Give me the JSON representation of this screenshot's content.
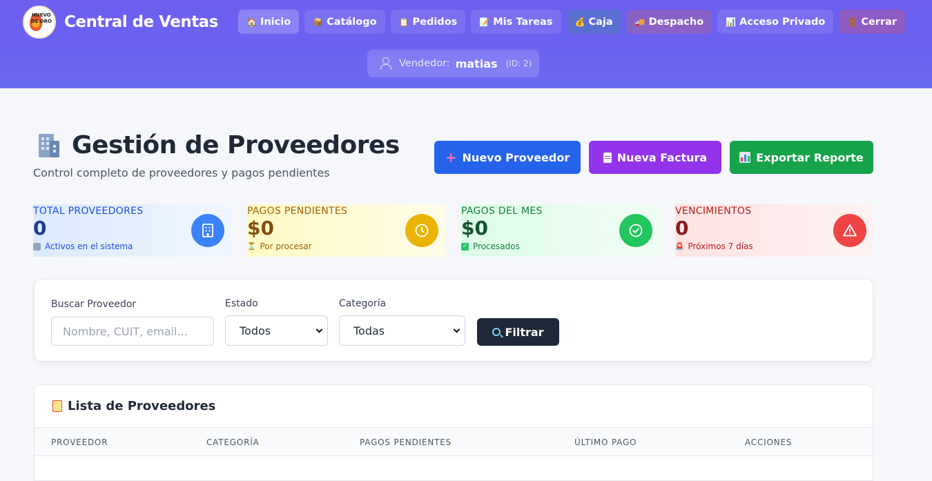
{
  "header": {
    "brand_title": "Central de Ventas",
    "logo_text": "HUEVO DE ORO",
    "nav": [
      {
        "label": "Inicio",
        "icon": "house-icon"
      },
      {
        "label": "Catálogo",
        "icon": "package-icon"
      },
      {
        "label": "Pedidos",
        "icon": "clipboard-icon"
      },
      {
        "label": "Mis Tareas",
        "icon": "memo-icon"
      },
      {
        "label": "Caja",
        "icon": "money-bag-icon"
      },
      {
        "label": "Despacho",
        "icon": "truck-icon"
      },
      {
        "label": "Acceso Privado",
        "icon": "bar-chart-icon"
      },
      {
        "label": "Cerrar",
        "icon": "door-icon"
      }
    ],
    "seller": {
      "prefix": "Vendedor:",
      "name": "matias",
      "id": "(ID: 2)"
    }
  },
  "page": {
    "title": "Gestión de Proveedores",
    "subtitle": "Control completo de proveedores y pagos pendientes"
  },
  "actions": {
    "new_provider": "Nuevo Proveedor",
    "new_invoice": "Nueva Factura",
    "export_report": "Exportar Reporte"
  },
  "stats": [
    {
      "label": "TOTAL PROVEEDORES",
      "value": "0",
      "note": "Activos en el sistema",
      "color": "#3b82f6"
    },
    {
      "label": "PAGOS PENDIENTES",
      "value": "$0",
      "note": "Por procesar",
      "color": "#eab308"
    },
    {
      "label": "PAGOS DEL MES",
      "value": "$0",
      "note": "Procesados",
      "color": "#22c55e"
    },
    {
      "label": "VENCIMIENTOS",
      "value": "0",
      "note": "Próximos 7 días",
      "color": "#ef4444"
    }
  ],
  "filters": {
    "search_label": "Buscar Proveedor",
    "search_placeholder": "Nombre, CUIT, email...",
    "estado_label": "Estado",
    "estado_value": "Todos",
    "categoria_label": "Categoría",
    "categoria_value": "Todas",
    "filter_button": "Filtrar"
  },
  "list": {
    "title": "Lista de Proveedores",
    "columns": [
      "PROVEEDOR",
      "CATEGORÍA",
      "PAGOS PENDIENTES",
      "ÚLTIMO PAGO",
      "ACCIONES"
    ]
  }
}
